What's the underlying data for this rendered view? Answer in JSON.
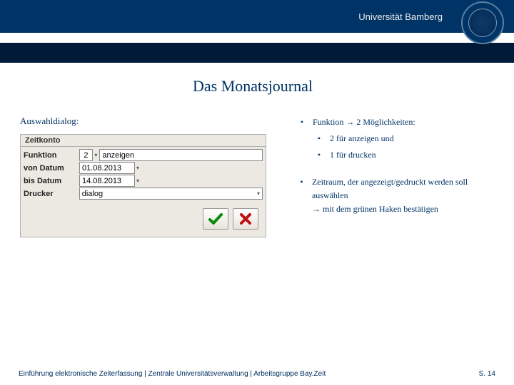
{
  "header": {
    "university": "Universität Bamberg"
  },
  "title": "Das Monatsjournal",
  "left_label": "Auswahldialog:",
  "dialog": {
    "title": "Zeitkonto",
    "rows": {
      "funktion_label": "Funktion",
      "funktion_value": "2",
      "funktion_text": "anzeigen",
      "von_label": "von Datum",
      "von_value": "01.08.2013",
      "bis_label": "bis Datum",
      "bis_value": "14.08.2013",
      "drucker_label": "Drucker",
      "drucker_value": "dialog"
    }
  },
  "right": {
    "b1": "Funktion",
    "b1_arrow": "→",
    "b1_tail": "2 Möglichkeiten:",
    "b1a": "2 für anzeigen und",
    "b1b": "1 für drucken",
    "b2": "Zeitraum, der angezeigt/gedruckt werden soll auswählen",
    "b2_arrow": "→",
    "b2_tail": "mit dem grünen Haken bestätigen"
  },
  "footer": {
    "left": "Einführung elektronische Zeiterfassung | Zentrale Universitätsverwaltung | Arbeitsgruppe Bay.Zeit",
    "right": "S. 14"
  }
}
